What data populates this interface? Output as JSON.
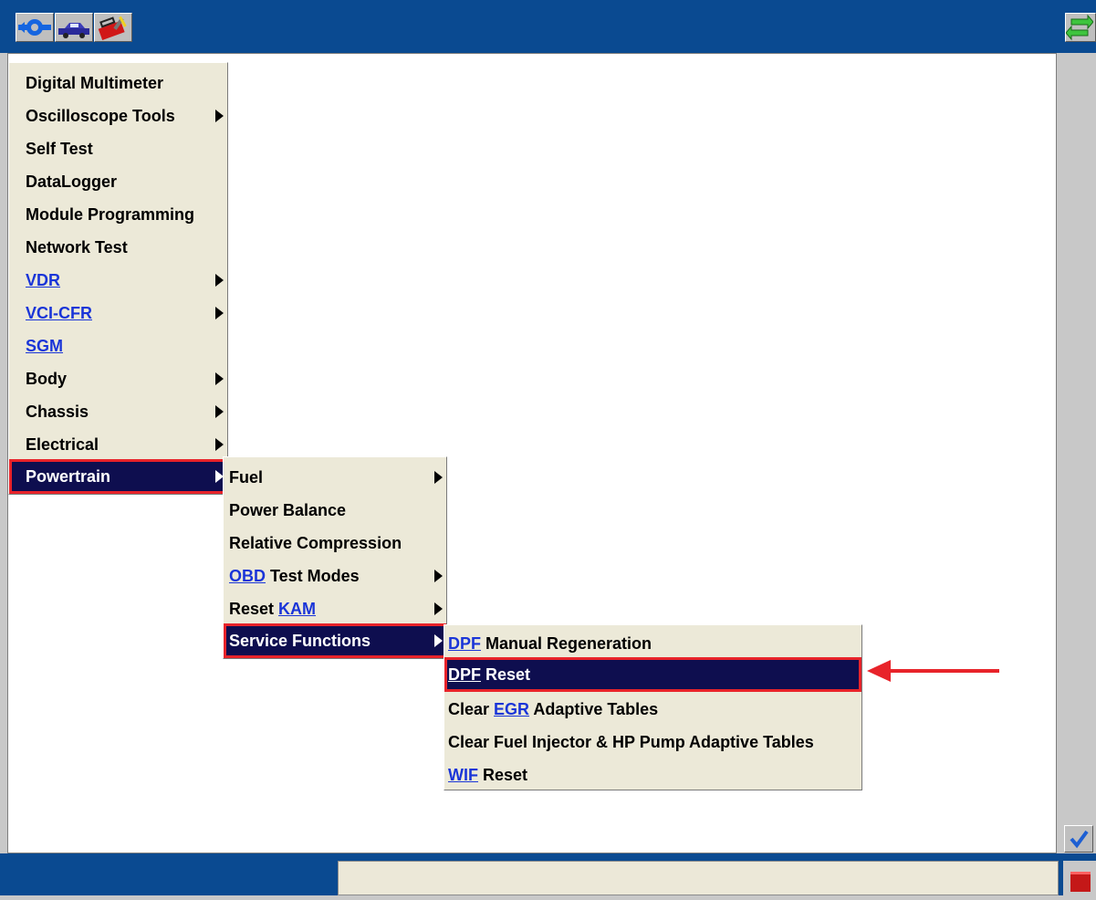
{
  "toolbar": {
    "icons": [
      "connect-icon",
      "vehicle-icon",
      "toolbox-icon",
      "swap-arrows-icon"
    ]
  },
  "menu_main": {
    "items": [
      {
        "label": "Digital Multimeter",
        "submenu": false
      },
      {
        "label": "Oscilloscope Tools",
        "submenu": true
      },
      {
        "label": "Self Test",
        "submenu": false
      },
      {
        "label": "DataLogger",
        "submenu": false
      },
      {
        "label": "Module Programming",
        "submenu": false
      },
      {
        "label": "Network Test",
        "submenu": false
      },
      {
        "label": "VDR",
        "submenu": true,
        "link": true
      },
      {
        "label": "VCI-CFR",
        "submenu": true,
        "link": true
      },
      {
        "label": "SGM",
        "submenu": false,
        "link": true
      },
      {
        "label": "Body",
        "submenu": true
      },
      {
        "label": "Chassis",
        "submenu": true
      },
      {
        "label": "Electrical",
        "submenu": true
      },
      {
        "label": "Powertrain",
        "submenu": true,
        "selected": true
      }
    ]
  },
  "menu_powertrain": {
    "items": [
      {
        "label": "Fuel",
        "submenu": true
      },
      {
        "label": "Power Balance",
        "submenu": false
      },
      {
        "label": "Relative Compression",
        "submenu": false
      },
      {
        "link": "OBD",
        "rest": " Test Modes",
        "submenu": true
      },
      {
        "prefix": "Reset ",
        "link": "KAM",
        "submenu": true
      },
      {
        "label": "Service Functions",
        "submenu": true,
        "selected": true
      }
    ]
  },
  "menu_service": {
    "items": [
      {
        "link": "DPF",
        "rest": " Manual Regeneration"
      },
      {
        "link": "DPF",
        "rest": " Reset",
        "selected": true
      },
      {
        "prefix": "Clear ",
        "link": "EGR",
        "rest": " Adaptive Tables"
      },
      {
        "label": "Clear Fuel Injector & HP Pump Adaptive Tables"
      },
      {
        "link": "WIF",
        "rest": " Reset"
      }
    ]
  },
  "colors": {
    "topbar": "#0a4a91",
    "menu_bg": "#ece9d8",
    "selected_bg": "#0e0e4f",
    "highlight_box": "#e8232a",
    "link": "#1a35d8"
  }
}
